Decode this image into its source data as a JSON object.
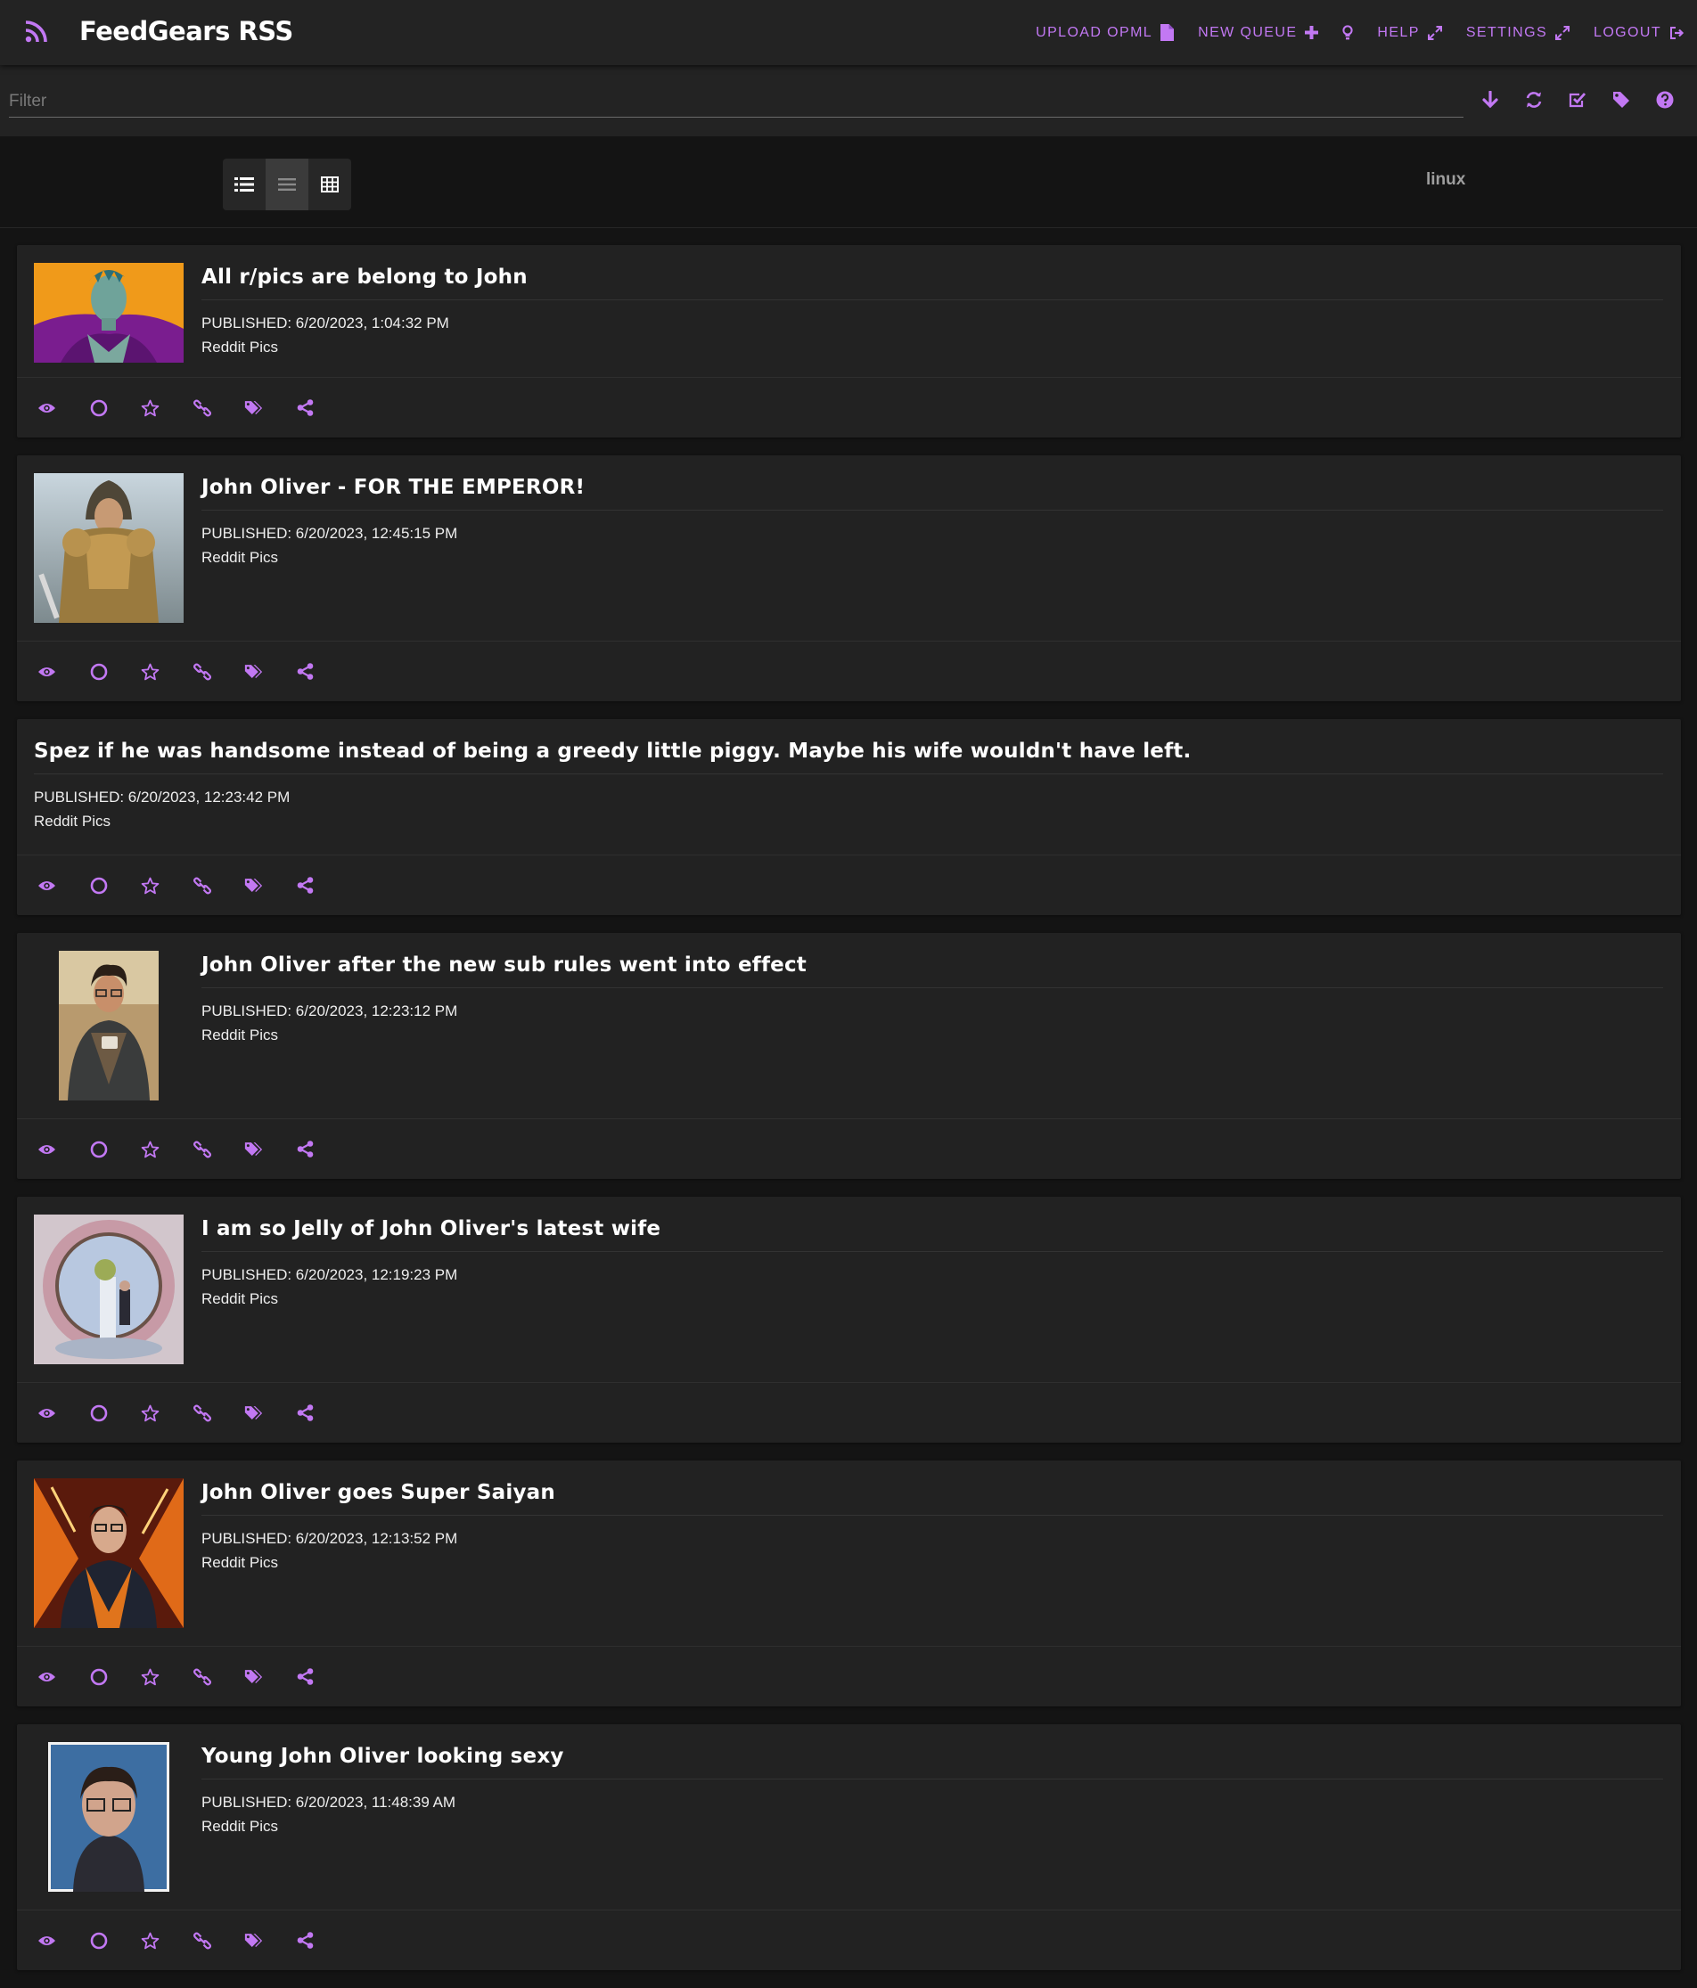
{
  "app": {
    "title": "FeedGears RSS"
  },
  "nav": {
    "upload_opml": "UPLOAD OPML",
    "new_queue": "NEW QUEUE",
    "help": "HELP",
    "settings": "SETTINGS",
    "logout": "LOGOUT"
  },
  "filter": {
    "placeholder": "Filter",
    "value": ""
  },
  "view": {
    "active_mode": "list",
    "modes": [
      "card",
      "list",
      "table"
    ],
    "label": "linux"
  },
  "colors": {
    "accent": "#c278f3",
    "background": "#141414",
    "card": "#222222",
    "topbar": "#232323"
  },
  "feed": {
    "items": [
      {
        "title": "All r/pics are belong to John",
        "published": "PUBLISHED: 6/20/2023, 1:04:32 PM",
        "source": "Reddit Pics",
        "has_thumbnail": true
      },
      {
        "title": "John Oliver - FOR THE EMPEROR!",
        "published": "PUBLISHED: 6/20/2023, 12:45:15 PM",
        "source": "Reddit Pics",
        "has_thumbnail": true
      },
      {
        "title": "Spez if he was handsome instead of being a greedy little piggy. Maybe his wife wouldn't have left.",
        "published": "PUBLISHED: 6/20/2023, 12:23:42 PM",
        "source": "Reddit Pics",
        "has_thumbnail": false
      },
      {
        "title": "John Oliver after the new sub rules went into effect",
        "published": "PUBLISHED: 6/20/2023, 12:23:12 PM",
        "source": "Reddit Pics",
        "has_thumbnail": true
      },
      {
        "title": "I am so Jelly of John Oliver's latest wife",
        "published": "PUBLISHED: 6/20/2023, 12:19:23 PM",
        "source": "Reddit Pics",
        "has_thumbnail": true
      },
      {
        "title": "John Oliver goes Super Saiyan",
        "published": "PUBLISHED: 6/20/2023, 12:13:52 PM",
        "source": "Reddit Pics",
        "has_thumbnail": true
      },
      {
        "title": "Young John Oliver looking sexy",
        "published": "PUBLISHED: 6/20/2023, 11:48:39 AM",
        "source": "Reddit Pics",
        "has_thumbnail": true
      }
    ],
    "action_icons": [
      "eye-icon",
      "circle-icon",
      "star-icon",
      "link-icon",
      "tags-icon",
      "share-icon"
    ]
  }
}
